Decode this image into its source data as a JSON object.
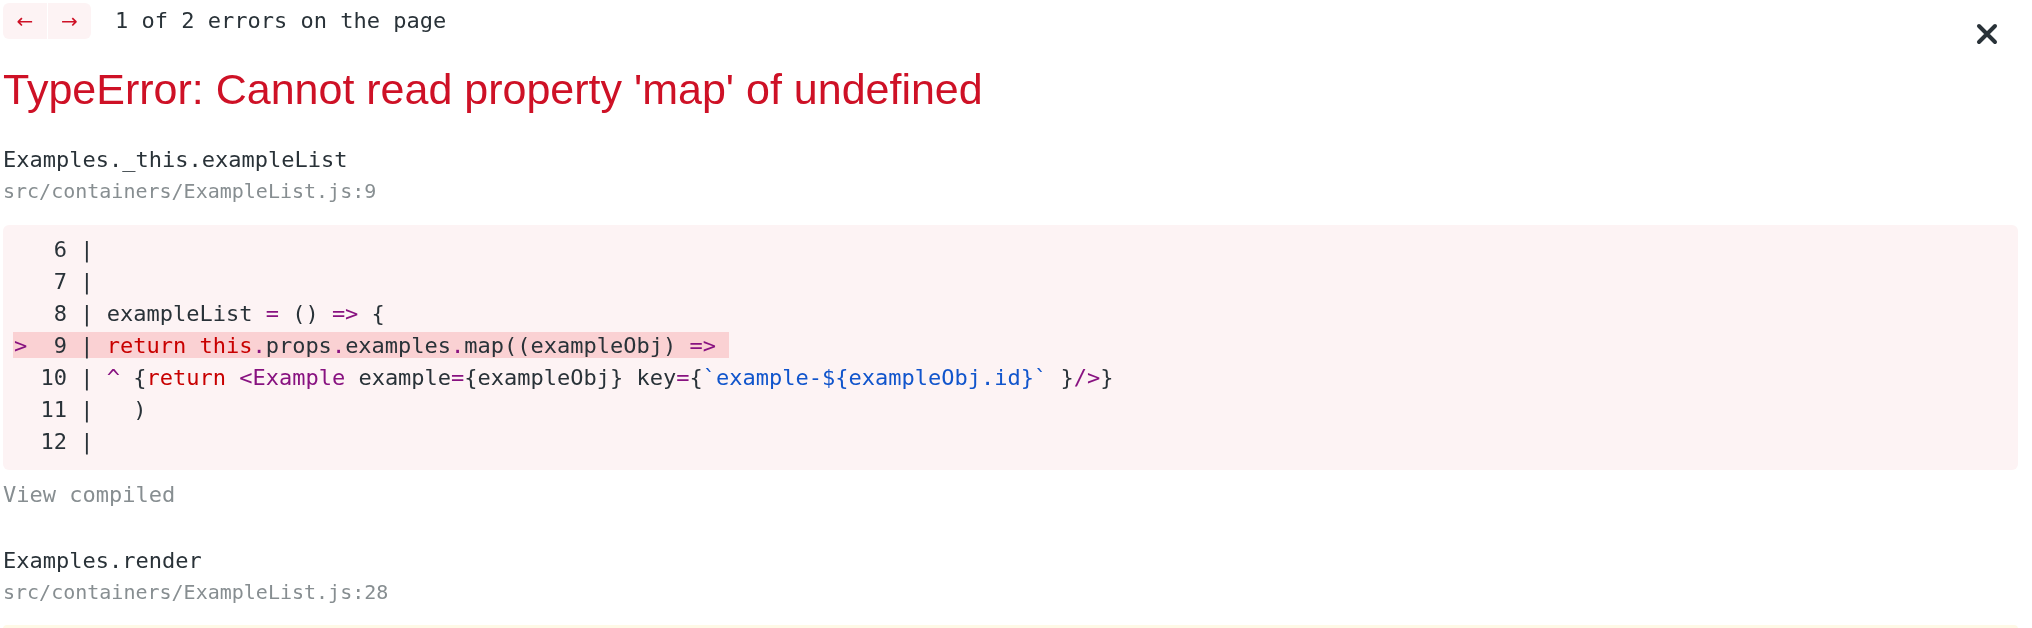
{
  "navigation": {
    "previous": "←",
    "next": "→",
    "counter": "1 of 2 errors on the page"
  },
  "error_title": "TypeError: Cannot read property 'map' of undefined",
  "stack_frames": [
    {
      "function": "Examples._this.exampleList",
      "location": "src/containers/ExampleList.js:9",
      "primary": true,
      "code_lines": [
        {
          "gutter": "6 |",
          "highlighted": false
        },
        {
          "gutter": "7 |",
          "highlighted": false
        },
        {
          "gutter": "8 |",
          "highlighted": false,
          "tokens": [
            {
              "kind": "plain",
              "text": "exampleList "
            },
            {
              "kind": "operator",
              "text": "="
            },
            {
              "kind": "plain",
              "text": " () "
            },
            {
              "kind": "operator",
              "text": "=>"
            },
            {
              "kind": "plain",
              "text": " {"
            }
          ]
        },
        {
          "marker": ">",
          "gutter": "9 |",
          "highlighted": true,
          "tokens": [
            {
              "kind": "keyword",
              "text": "return this"
            },
            {
              "kind": "operator",
              "text": "."
            },
            {
              "kind": "plain",
              "text": "props"
            },
            {
              "kind": "operator",
              "text": "."
            },
            {
              "kind": "plain",
              "text": "examples"
            },
            {
              "kind": "operator",
              "text": "."
            },
            {
              "kind": "plain",
              "text": "map((exampleObj) "
            },
            {
              "kind": "operator",
              "text": "=>"
            }
          ]
        },
        {
          "gutter": "10 |",
          "highlighted": false,
          "tokens": [
            {
              "kind": "operator",
              "text": "^"
            },
            {
              "kind": "plain",
              "text": " {"
            },
            {
              "kind": "keyword",
              "text": "return"
            },
            {
              "kind": "operator",
              "text": " <Example"
            },
            {
              "kind": "plain",
              "text": " example"
            },
            {
              "kind": "operator",
              "text": "="
            },
            {
              "kind": "plain",
              "text": "{exampleObj} key"
            },
            {
              "kind": "operator",
              "text": "="
            },
            {
              "kind": "plain",
              "text": "{"
            },
            {
              "kind": "string",
              "text": "`example-${exampleObj.id}`"
            },
            {
              "kind": "plain",
              "text": " }"
            },
            {
              "kind": "operator",
              "text": "/>"
            },
            {
              "kind": "plain",
              "text": "}"
            }
          ]
        },
        {
          "gutter": "11 |",
          "highlighted": false,
          "tokens": [
            {
              "kind": "plain",
              "text": "  )"
            }
          ]
        },
        {
          "gutter": "12 |",
          "highlighted": false
        }
      ],
      "toggle": "View compiled"
    },
    {
      "function": "Examples.render",
      "location": "src/containers/ExampleList.js:28",
      "primary": false
    }
  ]
}
